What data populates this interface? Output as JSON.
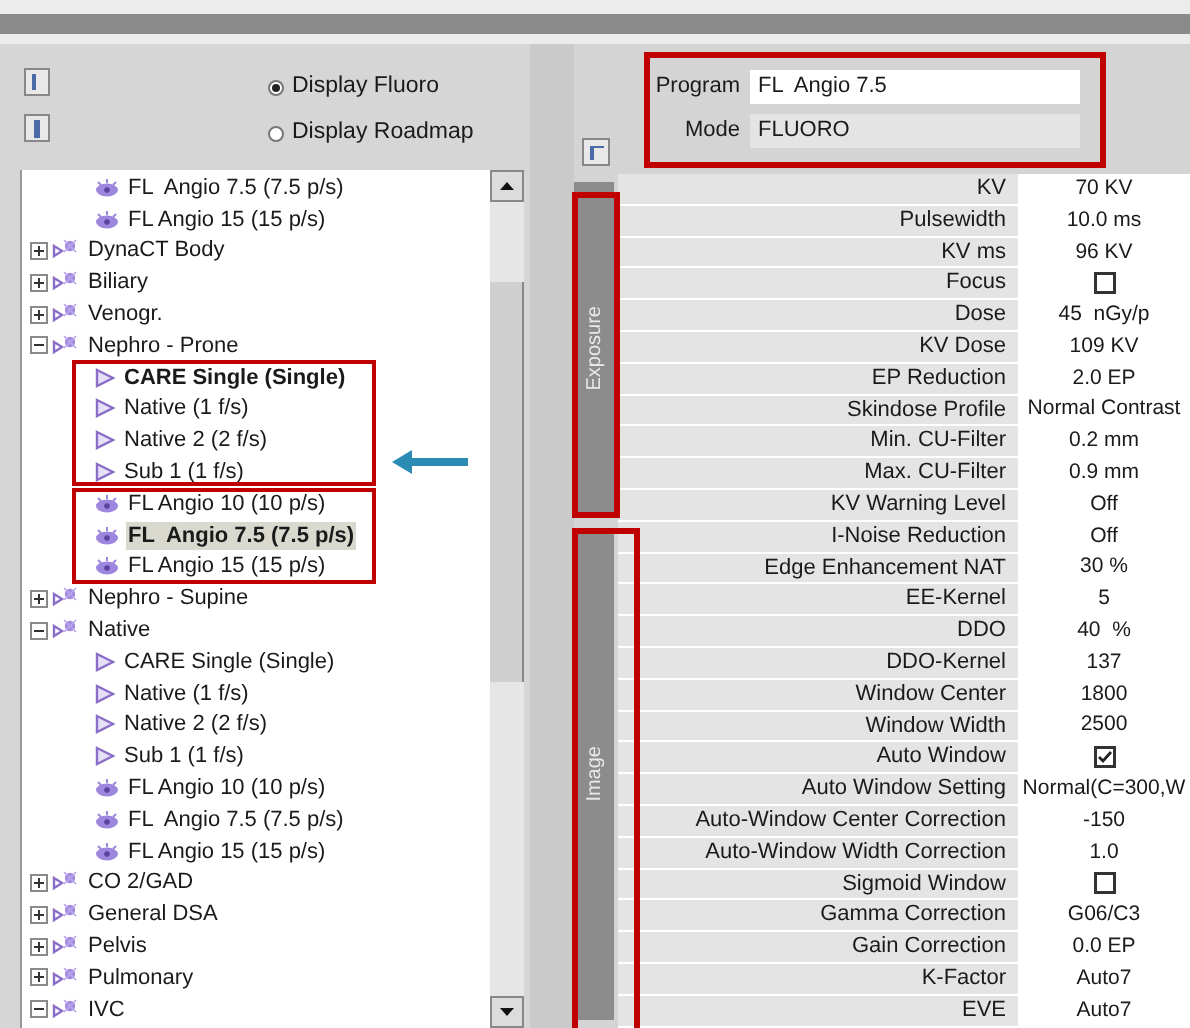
{
  "display_options": [
    {
      "label": "Display Fluoro",
      "selected": true
    },
    {
      "label": "Display Roadmap",
      "selected": false
    }
  ],
  "tree": [
    {
      "children": [
        {
          "kind": "fluoro",
          "label": "FL  Angio 7.5 (7.5 p/s)",
          "selected": false,
          "emphasized": false
        },
        {
          "kind": "fluoro",
          "label": "FL Angio 15 (15 p/s)",
          "selected": false,
          "emphasized": false
        }
      ]
    },
    {
      "label": "DynaCT Body",
      "expanded": false
    },
    {
      "label": "Biliary",
      "expanded": false
    },
    {
      "label": "Venogr.",
      "expanded": false
    },
    {
      "label": "Nephro - Prone",
      "expanded": true,
      "children": [
        {
          "kind": "acquisition",
          "label": "CARE Single (Single)",
          "selected": false,
          "emphasized": true
        },
        {
          "kind": "acquisition",
          "label": "Native (1 f/s)",
          "selected": false,
          "emphasized": false
        },
        {
          "kind": "acquisition",
          "label": "Native 2 (2 f/s)",
          "selected": false,
          "emphasized": false
        },
        {
          "kind": "acquisition",
          "label": "Sub 1 (1 f/s)",
          "selected": false,
          "emphasized": false
        },
        {
          "kind": "fluoro",
          "label": "FL Angio 10 (10 p/s)",
          "selected": false,
          "emphasized": false
        },
        {
          "kind": "fluoro",
          "label": "FL  Angio 7.5 (7.5 p/s)",
          "selected": true,
          "emphasized": true
        },
        {
          "kind": "fluoro",
          "label": "FL Angio 15 (15 p/s)",
          "selected": false,
          "emphasized": false
        }
      ]
    },
    {
      "label": "Nephro - Supine",
      "expanded": false
    },
    {
      "label": "Native",
      "expanded": true,
      "children": [
        {
          "kind": "acquisition",
          "label": "CARE Single (Single)",
          "selected": false,
          "emphasized": false
        },
        {
          "kind": "acquisition",
          "label": "Native (1 f/s)",
          "selected": false,
          "emphasized": false
        },
        {
          "kind": "acquisition",
          "label": "Native 2 (2 f/s)",
          "selected": false,
          "emphasized": false
        },
        {
          "kind": "acquisition",
          "label": "Sub 1 (1 f/s)",
          "selected": false,
          "emphasized": false
        },
        {
          "kind": "fluoro",
          "label": "FL Angio 10 (10 p/s)",
          "selected": false,
          "emphasized": false
        },
        {
          "kind": "fluoro",
          "label": "FL  Angio 7.5 (7.5 p/s)",
          "selected": false,
          "emphasized": false
        },
        {
          "kind": "fluoro",
          "label": "FL Angio 15 (15 p/s)",
          "selected": false,
          "emphasized": false
        }
      ]
    },
    {
      "label": "CO 2/GAD",
      "expanded": false
    },
    {
      "label": "General DSA",
      "expanded": false
    },
    {
      "label": "Pelvis",
      "expanded": false
    },
    {
      "label": "Pulmonary",
      "expanded": false
    },
    {
      "label": "IVC",
      "expanded": true
    }
  ],
  "program": {
    "label": "Program",
    "value": "FL  Angio 7.5",
    "disabled": false
  },
  "mode": {
    "label": "Mode",
    "value": "FLUORO",
    "disabled": true
  },
  "sections": [
    {
      "title": "Exposure",
      "rows": [
        {
          "kind": "text",
          "label": "KV",
          "value": "70 KV"
        },
        {
          "kind": "text",
          "label": "Pulsewidth",
          "value": "10.0 ms"
        },
        {
          "kind": "text",
          "label": "KV ms",
          "value": "96 KV"
        },
        {
          "kind": "checkbox",
          "label": "Focus",
          "checked": false
        },
        {
          "kind": "text",
          "label": "Dose",
          "value": "45  nGy/p"
        },
        {
          "kind": "text",
          "label": "KV Dose",
          "value": "109 KV"
        },
        {
          "kind": "text",
          "label": "EP Reduction",
          "value": "2.0 EP"
        },
        {
          "kind": "text",
          "label": "Skindose Profile",
          "value": "Normal Contrast"
        },
        {
          "kind": "text",
          "label": "Min. CU-Filter",
          "value": "0.2 mm"
        },
        {
          "kind": "text",
          "label": "Max. CU-Filter",
          "value": "0.9 mm"
        },
        {
          "kind": "text",
          "label": "KV Warning Level",
          "value": "Off"
        }
      ]
    },
    {
      "title": "Image",
      "rows": [
        {
          "kind": "text",
          "label": "I-Noise Reduction",
          "value": "Off"
        },
        {
          "kind": "text",
          "label": "Edge Enhancement NAT",
          "value": "30 %"
        },
        {
          "kind": "text",
          "label": "EE-Kernel",
          "value": "5"
        },
        {
          "kind": "text",
          "label": "DDO",
          "value": "40  %"
        },
        {
          "kind": "text",
          "label": "DDO-Kernel",
          "value": "137"
        },
        {
          "kind": "text",
          "label": "Window Center",
          "value": "1800"
        },
        {
          "kind": "text",
          "label": "Window Width",
          "value": "2500"
        },
        {
          "kind": "checkbox",
          "label": "Auto Window",
          "checked": true
        },
        {
          "kind": "text",
          "label": "Auto Window Setting",
          "value": "Normal(C=300,W"
        },
        {
          "kind": "text",
          "label": "Auto-Window Center Correction",
          "value": "-150"
        },
        {
          "kind": "text",
          "label": "Auto-Window Width Correction",
          "value": "1.0"
        },
        {
          "kind": "checkbox",
          "label": "Sigmoid Window",
          "checked": false
        },
        {
          "kind": "text",
          "label": "Gamma Correction",
          "value": "G06/C3"
        },
        {
          "kind": "text",
          "label": "Gain Correction",
          "value": "0.0 EP"
        },
        {
          "kind": "text",
          "label": "K-Factor",
          "value": "Auto7"
        },
        {
          "kind": "text",
          "label": "EVE",
          "value": "Auto7"
        }
      ]
    }
  ]
}
